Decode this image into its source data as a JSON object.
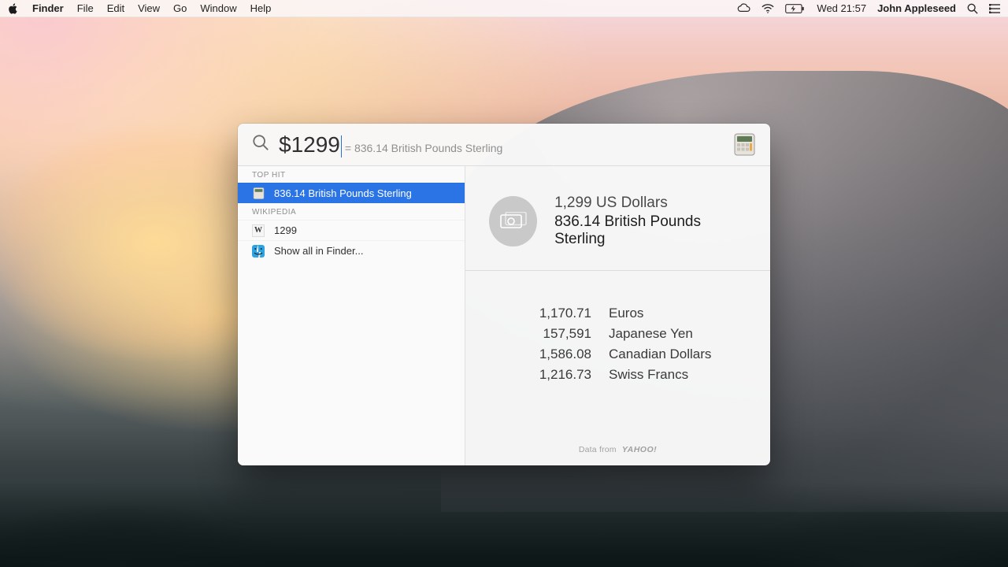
{
  "menubar": {
    "app": "Finder",
    "items": [
      "File",
      "Edit",
      "View",
      "Go",
      "Window",
      "Help"
    ],
    "clock": "Wed 21:57",
    "user": "John Appleseed"
  },
  "spotlight": {
    "query": "$1299",
    "inline_result": "= 836.14 British Pounds Sterling",
    "sidebar": {
      "section1": "TOP HIT",
      "top_hit": "836.14 British Pounds Sterling",
      "section2": "WIKIPEDIA",
      "wiki_item": "1299",
      "show_all": "Show all in Finder..."
    },
    "preview": {
      "amount_in": "1,299 US Dollars",
      "amount_out": "836.14 British Pounds Sterling",
      "rows": [
        {
          "amount": "1,170.71",
          "currency": "Euros"
        },
        {
          "amount": "157,591",
          "currency": "Japanese Yen"
        },
        {
          "amount": "1,586.08",
          "currency": "Canadian Dollars"
        },
        {
          "amount": "1,216.73",
          "currency": "Swiss Francs"
        }
      ],
      "attribution_prefix": "Data from",
      "attribution_brand": "YAHOO!"
    }
  }
}
